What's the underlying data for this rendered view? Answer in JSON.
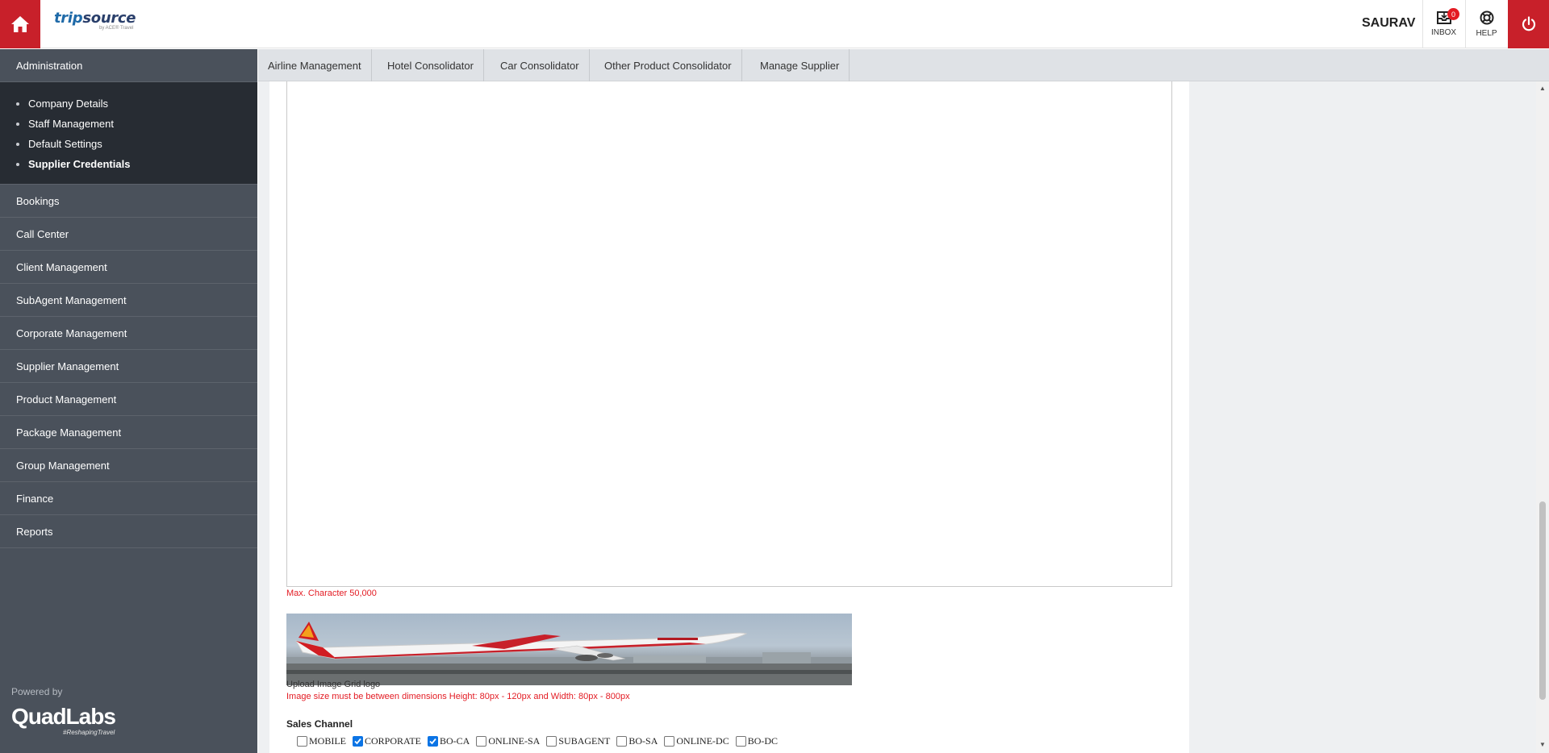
{
  "header": {
    "logo_text": "tripsource",
    "logo_tagline": "by ACE® Travel",
    "username": "SAURAV",
    "inbox_label": "INBOX",
    "inbox_count": "0",
    "help_label": "HELP"
  },
  "sidebar": {
    "administration": "Administration",
    "admin_items": [
      {
        "label": "Company Details",
        "active": false
      },
      {
        "label": "Staff Management",
        "active": false
      },
      {
        "label": "Default Settings",
        "active": false
      },
      {
        "label": "Supplier Credentials",
        "active": true
      }
    ],
    "items": [
      "Bookings",
      "Call Center",
      "Client Management",
      "SubAgent Management",
      "Corporate Management",
      "Supplier Management",
      "Product Management",
      "Package Management",
      "Group Management",
      "Finance",
      "Reports"
    ],
    "powered_by": "Powered by",
    "brand": "QuadLabs",
    "brand_tag": "#ReshapingTravel"
  },
  "tabs": [
    "Airline Management",
    "Hotel Consolidator",
    "Car Consolidator",
    "Other Product Consolidator",
    "Manage Supplier"
  ],
  "form": {
    "max_char_note": "Max. Character 50,000",
    "upload_label": "Upload Image Grid logo",
    "image_size_note": "Image size must be between dimensions Height: 80px - 120px and Width: 80px - 800px",
    "sales_channel_label": "Sales Channel",
    "channels": [
      {
        "label": "MOBILE",
        "checked": false
      },
      {
        "label": "CORPORATE",
        "checked": true
      },
      {
        "label": "BO-CA",
        "checked": true
      },
      {
        "label": "ONLINE-SA",
        "checked": false
      },
      {
        "label": "SUBAGENT",
        "checked": false
      },
      {
        "label": "BO-SA",
        "checked": false
      },
      {
        "label": "ONLINE-DC",
        "checked": false
      },
      {
        "label": "BO-DC",
        "checked": false
      }
    ]
  },
  "colors": {
    "brand_red": "#c8202a",
    "sidebar_bg": "#4a515b",
    "sidebar_sub_bg": "#272c33",
    "error_red": "#e31b23",
    "tab_bg": "#dfe2e6"
  }
}
